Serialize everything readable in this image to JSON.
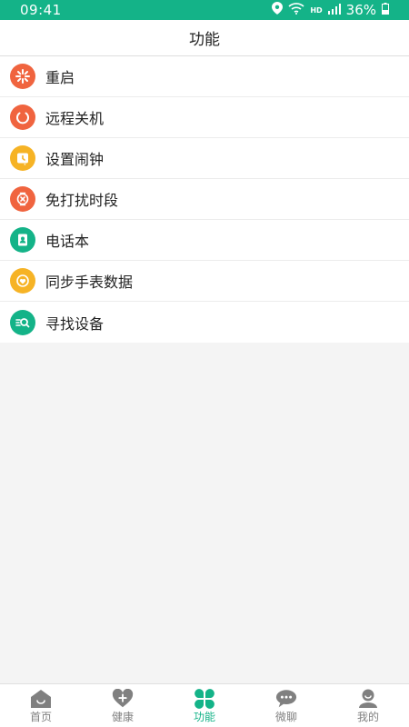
{
  "status_bar": {
    "time": "09:41",
    "network": "HD",
    "battery": "36%"
  },
  "header": {
    "title": "功能"
  },
  "menu": {
    "items": [
      {
        "label": "重启",
        "icon": "restart-icon",
        "color": "#f0643f"
      },
      {
        "label": "远程关机",
        "icon": "power-icon",
        "color": "#f0643f"
      },
      {
        "label": "设置闹钟",
        "icon": "alarm-icon",
        "color": "#f6b325"
      },
      {
        "label": "免打扰时段",
        "icon": "do-not-disturb-icon",
        "color": "#f0643f"
      },
      {
        "label": "电话本",
        "icon": "phonebook-icon",
        "color": "#14b388"
      },
      {
        "label": "同步手表数据",
        "icon": "sync-icon",
        "color": "#f6b325"
      },
      {
        "label": "寻找设备",
        "icon": "find-device-icon",
        "color": "#14b388"
      }
    ]
  },
  "tabs": [
    {
      "label": "首页",
      "icon": "home-icon",
      "active": false
    },
    {
      "label": "健康",
      "icon": "health-icon",
      "active": false
    },
    {
      "label": "功能",
      "icon": "functions-icon",
      "active": true
    },
    {
      "label": "微聊",
      "icon": "chat-icon",
      "active": false
    },
    {
      "label": "我的",
      "icon": "profile-icon",
      "active": false
    }
  ],
  "colors": {
    "accent": "#14b388",
    "inactive": "#808080"
  }
}
